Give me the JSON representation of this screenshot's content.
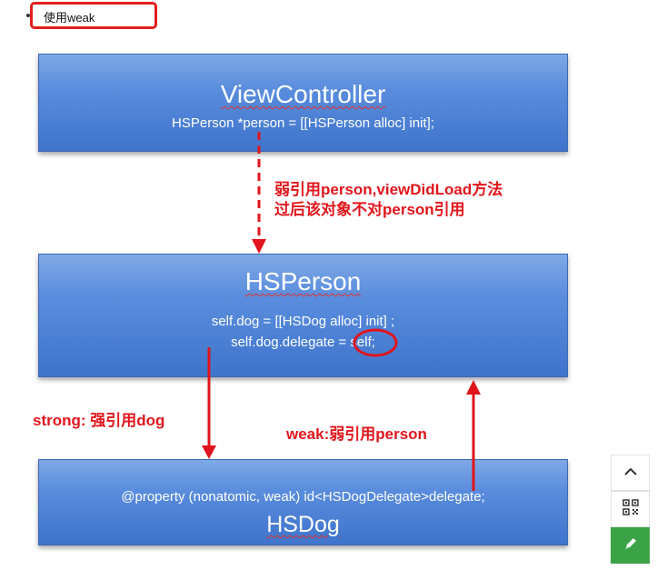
{
  "top_label": "使用weak",
  "view_controller": {
    "title": "ViewController",
    "code": "HSPerson *person = [[HSPerson alloc] init];"
  },
  "arrow1_note": {
    "line1": "弱引用person,viewDidLoad方法",
    "line2": "过后该对象不对person引用"
  },
  "hsperson": {
    "title": "HSPerson",
    "code1": "self.dog = [[HSDog alloc] init] ;",
    "code2": "self.dog.delegate = self;"
  },
  "strong_note": "strong: 强引用dog",
  "weak_note": "weak:弱引用person",
  "hsdog": {
    "code": "@property (nonatomic, weak) id<HSDogDelegate>delegate;",
    "title": "HSDog"
  },
  "sidebar": {
    "icons": [
      "chevron-up-icon",
      "qr-code-icon",
      "edit-pencil-icon"
    ]
  },
  "colors": {
    "box_blue": "#4a7fd4",
    "annotation_red": "#e0151b",
    "edit_green": "#3aa346"
  }
}
